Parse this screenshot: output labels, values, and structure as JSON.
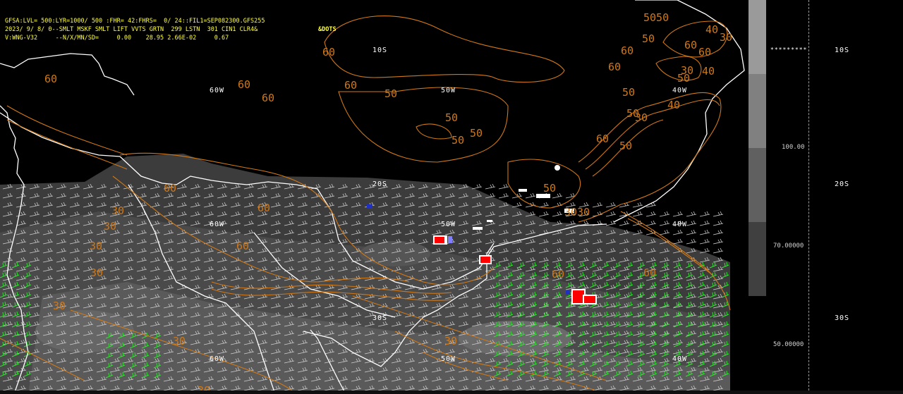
{
  "header": {
    "line1": "GFSA:LVL= 500:LYR=1000/ 500 :FHR= 42:FHRS=  0/ 24::FIL1=SEP082300.GFS255",
    "line2": "2023/ 9/ 8/ 0--SMLT MSKF SMLT LIFT VVTS GRTN  299 LSTN  301 CIN1 CLR4&",
    "line3": "V:WNG-V32     --N/X/MN/SD=     0.00    28.95 2.66E-02     0.67",
    "dots_tag": "&DOTS"
  },
  "map_labels": {
    "lon_60w_top": "60W",
    "lon_50w_top": "50W",
    "lon_40w_top": "40W",
    "lon_60w_mid": "60W",
    "lon_50w_mid": "50W",
    "lon_40w_mid": "40W",
    "lon_60w_bot": "60W",
    "lon_50w_bot": "50W",
    "lon_40w_bot": "40W",
    "lat_10s": "10S",
    "lat_20s": "20S",
    "lat_30s": "30S"
  },
  "contour_labels": [
    {
      "id": "c1",
      "text": "60"
    },
    {
      "id": "c2",
      "text": "60"
    },
    {
      "id": "c3",
      "text": "60"
    },
    {
      "id": "c4",
      "text": "60"
    },
    {
      "id": "c5",
      "text": "50"
    },
    {
      "id": "c6",
      "text": "50"
    },
    {
      "id": "c7",
      "text": "50"
    },
    {
      "id": "c8",
      "text": "50"
    },
    {
      "id": "c9",
      "text": "60"
    },
    {
      "id": "c10",
      "text": "5050"
    },
    {
      "id": "c11",
      "text": "40"
    },
    {
      "id": "c12",
      "text": "50"
    },
    {
      "id": "c13",
      "text": "60"
    },
    {
      "id": "c14",
      "text": "60"
    },
    {
      "id": "c15",
      "text": "30"
    },
    {
      "id": "c16",
      "text": "60"
    },
    {
      "id": "c17",
      "text": "30"
    },
    {
      "id": "c18",
      "text": "50"
    },
    {
      "id": "c19",
      "text": "60"
    },
    {
      "id": "c20",
      "text": "50"
    },
    {
      "id": "c21",
      "text": "40"
    },
    {
      "id": "c22",
      "text": "50"
    },
    {
      "id": "c23",
      "text": "60"
    },
    {
      "id": "c24",
      "text": "50"
    },
    {
      "id": "c25",
      "text": "40"
    },
    {
      "id": "c26",
      "text": "30"
    },
    {
      "id": "c27",
      "text": "50"
    },
    {
      "id": "c28",
      "text": "3030"
    },
    {
      "id": "c29",
      "text": "30"
    },
    {
      "id": "c30",
      "text": "30"
    },
    {
      "id": "c31",
      "text": "30"
    },
    {
      "id": "c32",
      "text": "60"
    },
    {
      "id": "c33",
      "text": "30"
    },
    {
      "id": "c34",
      "text": "60"
    },
    {
      "id": "c35",
      "text": "60"
    },
    {
      "id": "c36",
      "text": "30"
    },
    {
      "id": "c37",
      "text": "30"
    },
    {
      "id": "c38",
      "text": "60"
    },
    {
      "id": "c39",
      "text": "60"
    },
    {
      "id": "c40",
      "text": "30"
    },
    {
      "id": "c41",
      "text": "30"
    }
  ],
  "colorbar": {
    "values": [
      "100.00",
      "70.00000",
      "50.00000"
    ],
    "colors": [
      "#9a9a9a",
      "#808080",
      "#606060",
      "#404040"
    ]
  },
  "right_lat_labels": {
    "lat_10s": "10S",
    "lat_20s": "20S",
    "lat_30s": "30S"
  },
  "colors": {
    "contour": "#d07818",
    "coast": "#ffffff",
    "wind_barb_green": "#30e030",
    "cloud_gray": "#555555",
    "box_red": "#ff0000"
  }
}
